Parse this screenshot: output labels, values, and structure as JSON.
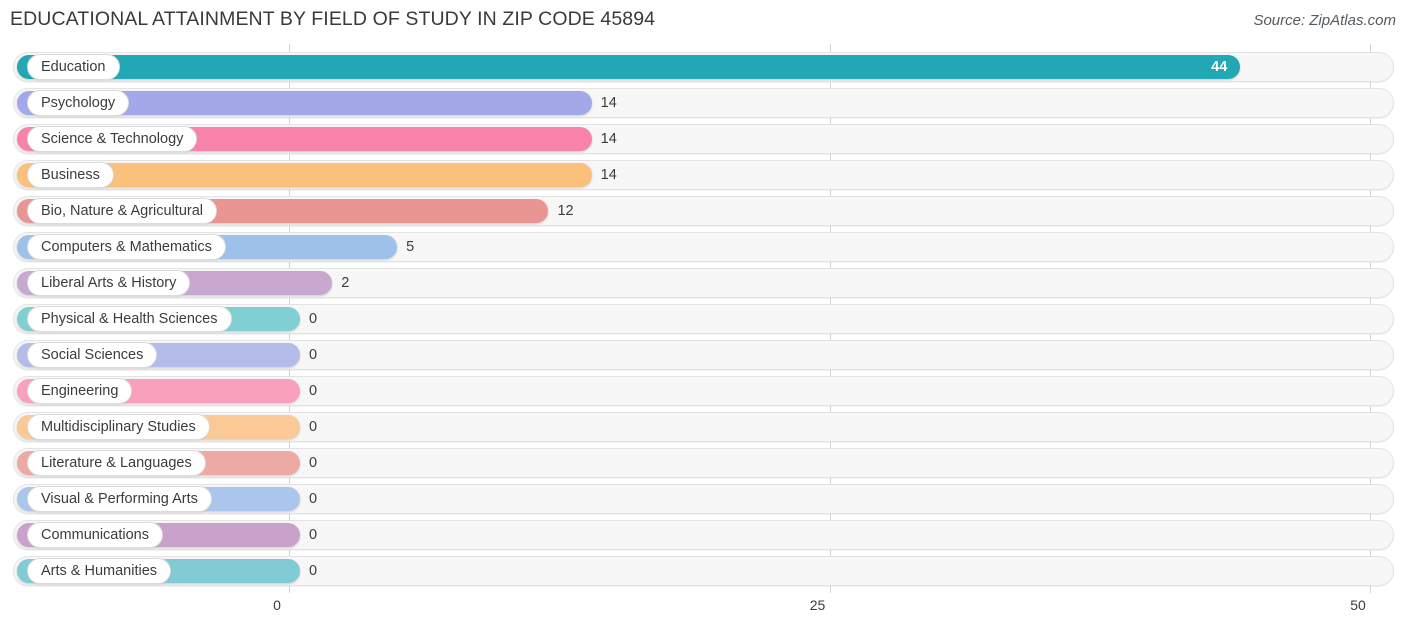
{
  "header": {
    "title": "EDUCATIONAL ATTAINMENT BY FIELD OF STUDY IN ZIP CODE 45894",
    "source": "Source: ZipAtlas.com"
  },
  "chart_data": {
    "type": "bar",
    "orientation": "horizontal",
    "title": "EDUCATIONAL ATTAINMENT BY FIELD OF STUDY IN ZIP CODE 45894",
    "subtitle": "Source: ZipAtlas.com",
    "xlabel": "",
    "ylabel": "",
    "xlim": [
      0,
      50
    ],
    "xticks": [
      0,
      25,
      50
    ],
    "xtick_labels": [
      "0",
      "25",
      "50"
    ],
    "grid": true,
    "legend": false,
    "categories": [
      "Education",
      "Psychology",
      "Science & Technology",
      "Business",
      "Bio, Nature & Agricultural",
      "Computers & Mathematics",
      "Liberal Arts & History",
      "Physical & Health Sciences",
      "Social Sciences",
      "Engineering",
      "Multidisciplinary Studies",
      "Literature & Languages",
      "Visual & Performing Arts",
      "Communications",
      "Arts & Humanities"
    ],
    "values": [
      44,
      14,
      14,
      14,
      12,
      5,
      2,
      0,
      0,
      0,
      0,
      0,
      0,
      0,
      0
    ],
    "value_labels": [
      "44",
      "14",
      "14",
      "14",
      "12",
      "5",
      "2",
      "0",
      "0",
      "0",
      "0",
      "0",
      "0",
      "0",
      "0"
    ],
    "colors": [
      "#22a7b5",
      "#a3a9e8",
      "#f783ab",
      "#fbc07c",
      "#e99592",
      "#9dc1e8",
      "#c9a8cf",
      "#7fcfd3",
      "#b4bce9",
      "#f9a0bd",
      "#fbc995",
      "#edaaa5",
      "#aac6ec",
      "#c9a2cc",
      "#80cbd4"
    ]
  },
  "axis": {
    "ticks": [
      {
        "label": "0"
      },
      {
        "label": "25"
      },
      {
        "label": "50"
      }
    ]
  }
}
